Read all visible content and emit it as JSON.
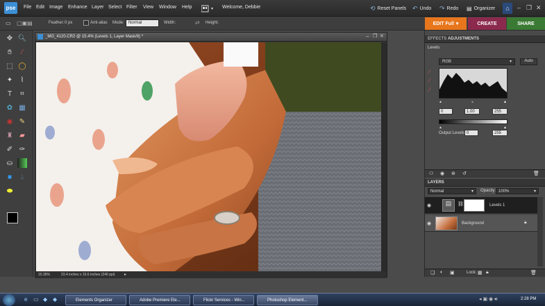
{
  "app": {
    "logo": "pse",
    "menu": [
      "File",
      "Edit",
      "Image",
      "Enhance",
      "Layer",
      "Select",
      "Filter",
      "View",
      "Window",
      "Help"
    ],
    "welcome": "Welcome, Debbie",
    "toolbar": {
      "reset_panels": "Reset Panels",
      "undo": "Undo",
      "redo": "Redo",
      "organizer": "Organizer"
    }
  },
  "options_bar": {
    "feather_label": "Feather:",
    "feather_value": "0 px",
    "antialias_label": "Anti-alias",
    "mode_label": "Mode:",
    "mode_value": "Normal",
    "width_label": "Width:",
    "height_label": "Height:"
  },
  "mode_tabs": {
    "edit_full": "EDIT Full",
    "create": "CREATE",
    "share": "SHARE"
  },
  "document": {
    "title": "_MG_4120.CR2 @ 15.4% (Levels 1, Layer Mask/8) *",
    "zoom": "15.36%",
    "dimensions": "23.4 inches x 15.6 inches (240 ppi)"
  },
  "adjustments_panel": {
    "tabs": [
      "EFFECTS",
      "ADJUSTMENTS"
    ],
    "panel_name": "Levels",
    "channel": "RGB",
    "auto_label": "Auto",
    "input_levels": [
      "0",
      "1.00",
      "255"
    ],
    "output_label": "Output Levels:",
    "output_levels": [
      "0",
      "255"
    ]
  },
  "layers_panel": {
    "tab": "LAYERS",
    "blend_mode": "Normal",
    "opacity_label": "Opacity:",
    "opacity_value": "100%",
    "layers": [
      {
        "name": "Levels 1",
        "selected": true
      },
      {
        "name": "Background",
        "locked": true
      }
    ],
    "lock_label": "Lock:"
  },
  "taskbar": {
    "buttons": [
      "Elements Organizer",
      "Adobe Premiere Ele...",
      "Flickr Services - Win...",
      "Photoshop Element..."
    ],
    "time": "2:28 PM"
  },
  "colors": {
    "edit_tab": "#e7761c",
    "create_tab": "#8b2a4c",
    "share_tab": "#3a7a34"
  }
}
